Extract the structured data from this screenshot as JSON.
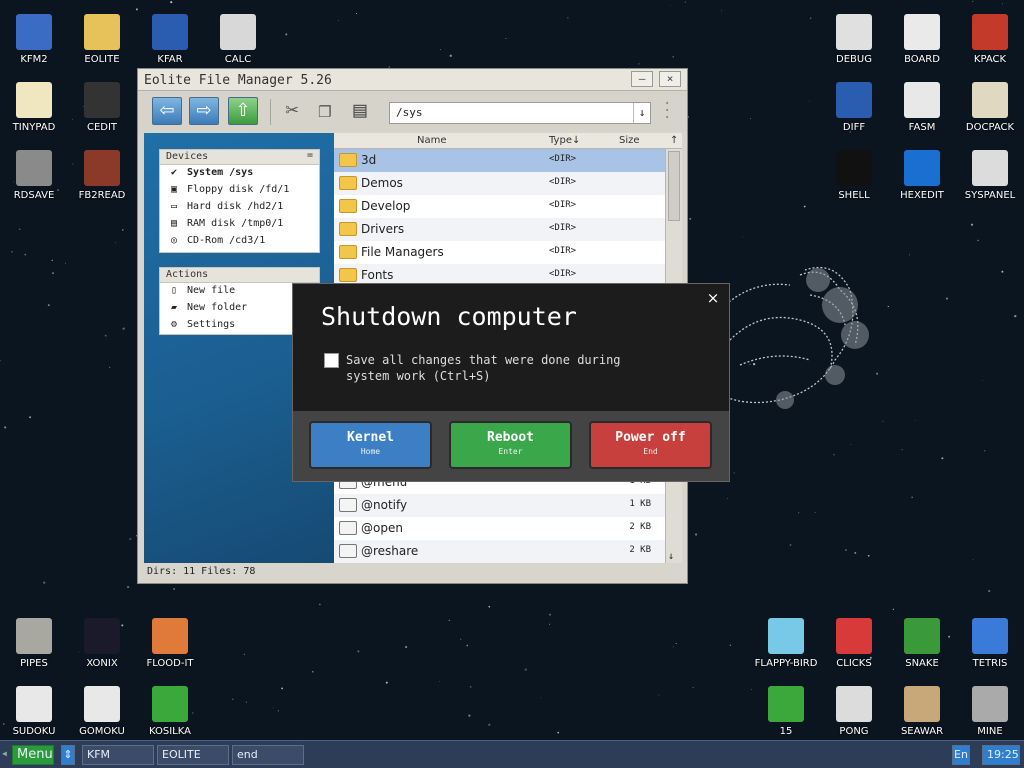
{
  "desktop_icons_left": [
    {
      "label": "KFM2",
      "icon": "floppy-icon"
    },
    {
      "label": "EOLITE",
      "icon": "folder-icon"
    },
    {
      "label": "KFAR",
      "icon": "kfar-icon"
    },
    {
      "label": "CALC",
      "icon": "calculator-icon"
    },
    {
      "label": "TINYPAD",
      "icon": "notepad-icon"
    },
    {
      "label": "CEDIT",
      "icon": "code-icon"
    },
    {
      "label": "RDSAVE",
      "icon": "rdsave-icon"
    },
    {
      "label": "FB2READ",
      "icon": "book-icon"
    }
  ],
  "desktop_icons_right": [
    {
      "label": "DEBUG",
      "icon": "debug-icon"
    },
    {
      "label": "BOARD",
      "icon": "board-icon"
    },
    {
      "label": "KPACK",
      "icon": "hammer-icon"
    },
    {
      "label": "DIFF",
      "icon": "diff-icon"
    },
    {
      "label": "FASM",
      "icon": "fasm-icon"
    },
    {
      "label": "DOCPACK",
      "icon": "cabinet-icon"
    },
    {
      "label": "SHELL",
      "icon": "terminal-icon"
    },
    {
      "label": "HEXEDIT",
      "icon": "hexedit-icon"
    },
    {
      "label": "SYSPANEL",
      "icon": "sliders-icon"
    }
  ],
  "desktop_icons_bottom": [
    {
      "label": "PIPES",
      "icon": "pipes-icon"
    },
    {
      "label": "XONIX",
      "icon": "xonix-icon"
    },
    {
      "label": "FLOOD-IT",
      "icon": "flood-icon"
    },
    {
      "label": "SUDOKU",
      "icon": "sudoku-icon"
    },
    {
      "label": "GOMOKU",
      "icon": "gomoku-icon"
    },
    {
      "label": "KOSILKA",
      "icon": "mower-icon"
    },
    {
      "label": "FLAPPY-BIRD",
      "icon": "bird-icon"
    },
    {
      "label": "CLICKS",
      "icon": "clicks-icon"
    },
    {
      "label": "SNAKE",
      "icon": "snake-icon"
    },
    {
      "label": "TETRIS",
      "icon": "tetris-icon"
    },
    {
      "label": "15",
      "icon": "fifteen-icon"
    },
    {
      "label": "PONG",
      "icon": "pong-icon"
    },
    {
      "label": "SEAWAR",
      "icon": "ship-icon"
    },
    {
      "label": "MINE",
      "icon": "mine-icon"
    }
  ],
  "file_manager": {
    "title": "Eolite File Manager 5.26",
    "minimize": "–",
    "close": "×",
    "path": "/sys",
    "devices_header": "Devices",
    "devices": [
      {
        "label": "System /sys",
        "icon": "system-icon"
      },
      {
        "label": "Floppy disk /fd/1",
        "icon": "floppy-icon"
      },
      {
        "label": "Hard disk /hd2/1",
        "icon": "harddisk-icon"
      },
      {
        "label": "RAM disk /tmp0/1",
        "icon": "ram-icon"
      },
      {
        "label": "CD-Rom /cd3/1",
        "icon": "cdrom-icon"
      }
    ],
    "actions_header": "Actions",
    "actions": [
      {
        "label": "New file",
        "icon": "new-file-icon"
      },
      {
        "label": "New folder",
        "icon": "new-folder-icon"
      },
      {
        "label": "Settings",
        "icon": "settings-icon"
      }
    ],
    "columns": {
      "name": "Name",
      "type": "Type↓",
      "size": "Size"
    },
    "files_top": [
      {
        "name": "3d",
        "type": "<DIR>",
        "size": ""
      },
      {
        "name": "Demos",
        "type": "<DIR>",
        "size": ""
      },
      {
        "name": "Develop",
        "type": "<DIR>",
        "size": ""
      },
      {
        "name": "Drivers",
        "type": "<DIR>",
        "size": ""
      },
      {
        "name": "File Managers",
        "type": "<DIR>",
        "size": ""
      },
      {
        "name": "Fonts",
        "type": "<DIR>",
        "size": ""
      }
    ],
    "files_bottom": [
      {
        "name": "@menu",
        "type": "",
        "size": "1 KB"
      },
      {
        "name": "@notify",
        "type": "",
        "size": "1 KB"
      },
      {
        "name": "@open",
        "type": "",
        "size": "2 KB"
      },
      {
        "name": "@reshare",
        "type": "",
        "size": "2 KB"
      }
    ],
    "status": "Dirs: 11  Files: 78"
  },
  "dialog": {
    "title": "Shutdown computer",
    "close": "×",
    "checkbox_text": "Save all changes that were done during system work (Ctrl+S)",
    "buttons": [
      {
        "label": "Kernel",
        "key": "Home",
        "color": "#3c7fc4"
      },
      {
        "label": "Reboot",
        "key": "Enter",
        "color": "#3aa84a"
      },
      {
        "label": "Power off",
        "key": "End",
        "color": "#c7403d"
      }
    ]
  },
  "taskbar": {
    "menu": "Menu",
    "switcher": "⇕",
    "tasks": [
      "KFM",
      "EOLITE",
      "end"
    ],
    "lang": "En",
    "time": "19:25"
  }
}
